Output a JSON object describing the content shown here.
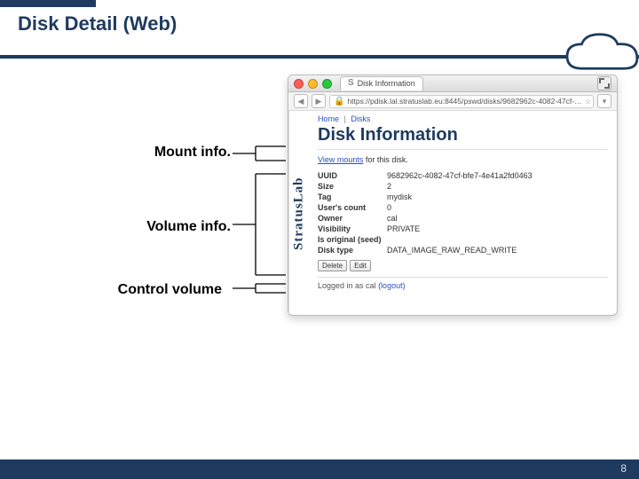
{
  "slide": {
    "title": "Disk Detail (Web)",
    "page": "8",
    "annotations": {
      "mount": "Mount info.",
      "volume": "Volume info.",
      "control": "Control volume"
    }
  },
  "browser": {
    "tab_title": "Disk Information",
    "url": "https://pdisk.lal.stratuslab.eu:8445/pswd/disks/9682962c-4082-47cf-…"
  },
  "page": {
    "sidebar": "StratusLab",
    "crumb": {
      "home": "Home",
      "disks": "Disks"
    },
    "heading": "Disk Information",
    "view_mounts_link": "View mounts",
    "view_mounts_tail": " for this disk.",
    "rows": {
      "uuid_k": "UUID",
      "uuid_v": "9682962c-4082-47cf-bfe7-4e41a2fd0463",
      "size_k": "Size",
      "size_v": "2",
      "tag_k": "Tag",
      "tag_v": "mydisk",
      "users_k": "User's count",
      "users_v": "0",
      "owner_k": "Owner",
      "owner_v": "cal",
      "vis_k": "Visibility",
      "vis_v": "PRIVATE",
      "seed_k": "Is original (seed)",
      "seed_v": "",
      "type_k": "Disk type",
      "type_v": "DATA_IMAGE_RAW_READ_WRITE"
    },
    "buttons": {
      "delete": "Delete",
      "edit": "Edit"
    },
    "login_text": "Logged in as cal ",
    "logout": "(logout)"
  }
}
